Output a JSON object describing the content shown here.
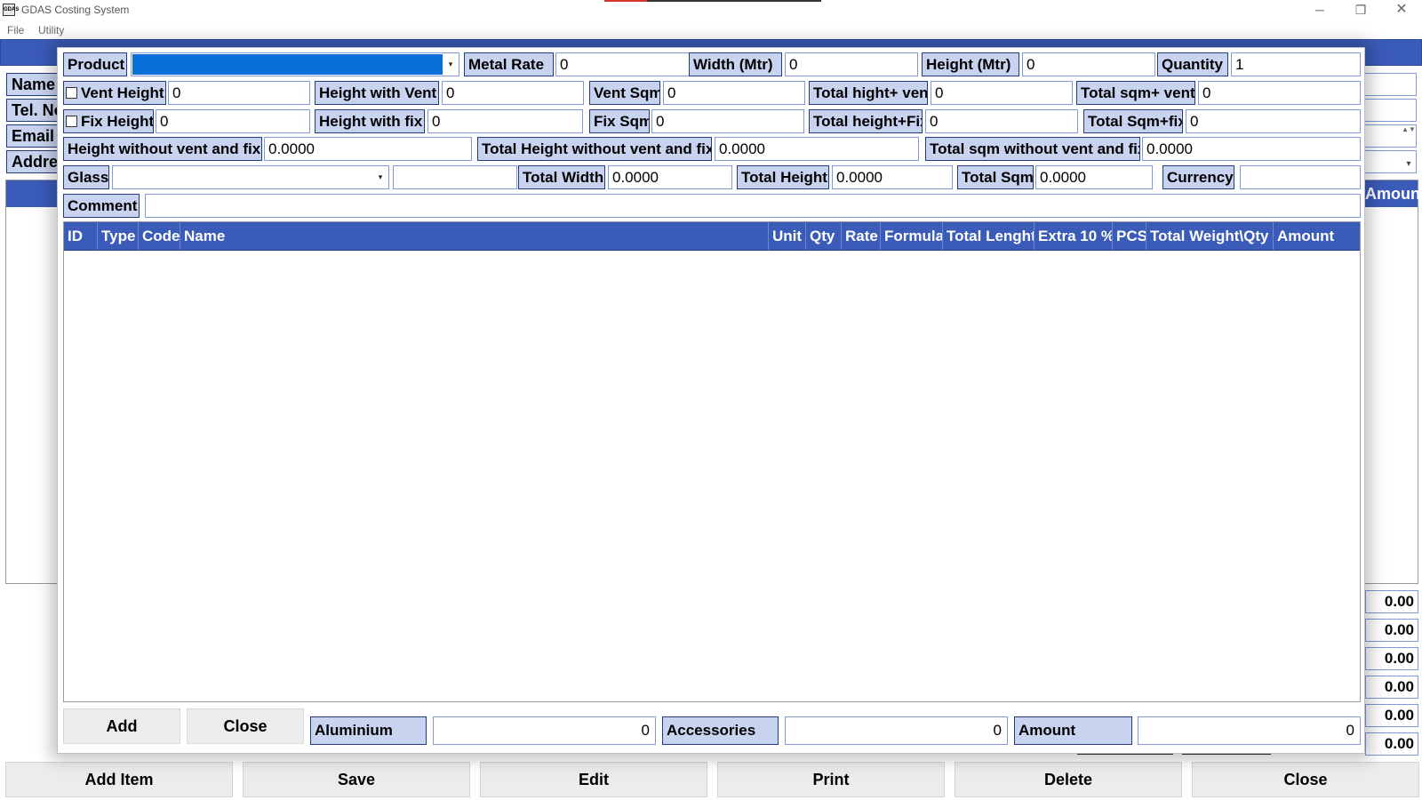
{
  "window": {
    "title": "GDAS Costing System",
    "icon_text": "GDAS",
    "minimize_glyph": "─",
    "maximize_glyph": "❐",
    "close_glyph": "✕"
  },
  "menu": {
    "file": "File",
    "utility": "Utility"
  },
  "background_form": {
    "labels": {
      "name": "Name",
      "tel": "Tel. No",
      "email": "Email",
      "address": "Address"
    },
    "grid_amount_header": "Amount",
    "totals": [
      "0.00",
      "0.00",
      "0.00",
      "0.00",
      "0.00",
      "0.00"
    ],
    "buttons": {
      "add_item": "Add Item",
      "save": "Save",
      "edit": "Edit",
      "print": "Print",
      "delete": "Delete",
      "close": "Close"
    }
  },
  "dialog": {
    "row1": {
      "product_label": "Product",
      "product_value": "",
      "metal_rate_label": "Metal Rate",
      "metal_rate_value": "0",
      "width_label": "Width (Mtr)",
      "width_value": "0",
      "height_label": "Height (Mtr)",
      "height_value": "0",
      "quantity_label": "Quantity",
      "quantity_value": "1"
    },
    "row2": {
      "vent_height_label": "Vent Height",
      "vent_height_value": "0",
      "height_with_vent_label": "Height with Vent",
      "height_with_vent_value": "0",
      "vent_sqm_label": "Vent Sqm",
      "vent_sqm_value": "0",
      "total_height_vent_label": "Total hight+ vent",
      "total_height_vent_value": "0",
      "total_sqm_vent_label": "Total sqm+ vent",
      "total_sqm_vent_value": "0"
    },
    "row3": {
      "fix_height_label": "Fix Height",
      "fix_height_value": "0",
      "height_with_fix_label": "Height with fix",
      "height_with_fix_value": "0",
      "fix_sqm_label": "Fix Sqm",
      "fix_sqm_value": "0",
      "total_height_fix_label": "Total height+Fix",
      "total_height_fix_value": "0",
      "total_sqm_fix_label": "Total Sqm+fix",
      "total_sqm_fix_value": "0"
    },
    "row4": {
      "hwo_label": "Height without vent and fix",
      "hwo_value": "0.0000",
      "thwo_label": "Total Height without vent and fix",
      "thwo_value": "0.0000",
      "tsqmwo_label": "Total sqm without vent and fix",
      "tsqmwo_value": "0.0000"
    },
    "row5": {
      "glass_label": "Glass",
      "glass_value": "",
      "glass_extra": "",
      "total_width_label": "Total Width",
      "total_width_value": "0.0000",
      "total_height_label": "Total Height",
      "total_height_value": "0.0000",
      "total_sqm_label": "Total Sqm",
      "total_sqm_value": "0.0000",
      "currency_label": "Currency",
      "currency_value": ""
    },
    "row6": {
      "comment_label": "Comment",
      "comment_value": ""
    },
    "grid_columns": [
      "ID",
      "Type",
      "Code",
      "Name",
      "Unit",
      "Qty",
      "Rate",
      "Formula",
      "Total Lenght",
      "Extra 10 %",
      "PCS",
      "Total Weight\\Qty",
      "Amount"
    ],
    "footer": {
      "add": "Add",
      "close": "Close",
      "aluminium_label": "Aluminium",
      "aluminium_value": "0",
      "accessories_label": "Accessories",
      "accessories_value": "0",
      "amount_label": "Amount",
      "amount_value": "0"
    },
    "dropdown_glyph": "▾",
    "spin_glyph": "▲▼"
  },
  "colors": {
    "header_blue": "#3a5bb8",
    "label_bg": "#c8d3ef",
    "selection_blue": "#0a6fd6",
    "button_bg": "#ececec"
  }
}
